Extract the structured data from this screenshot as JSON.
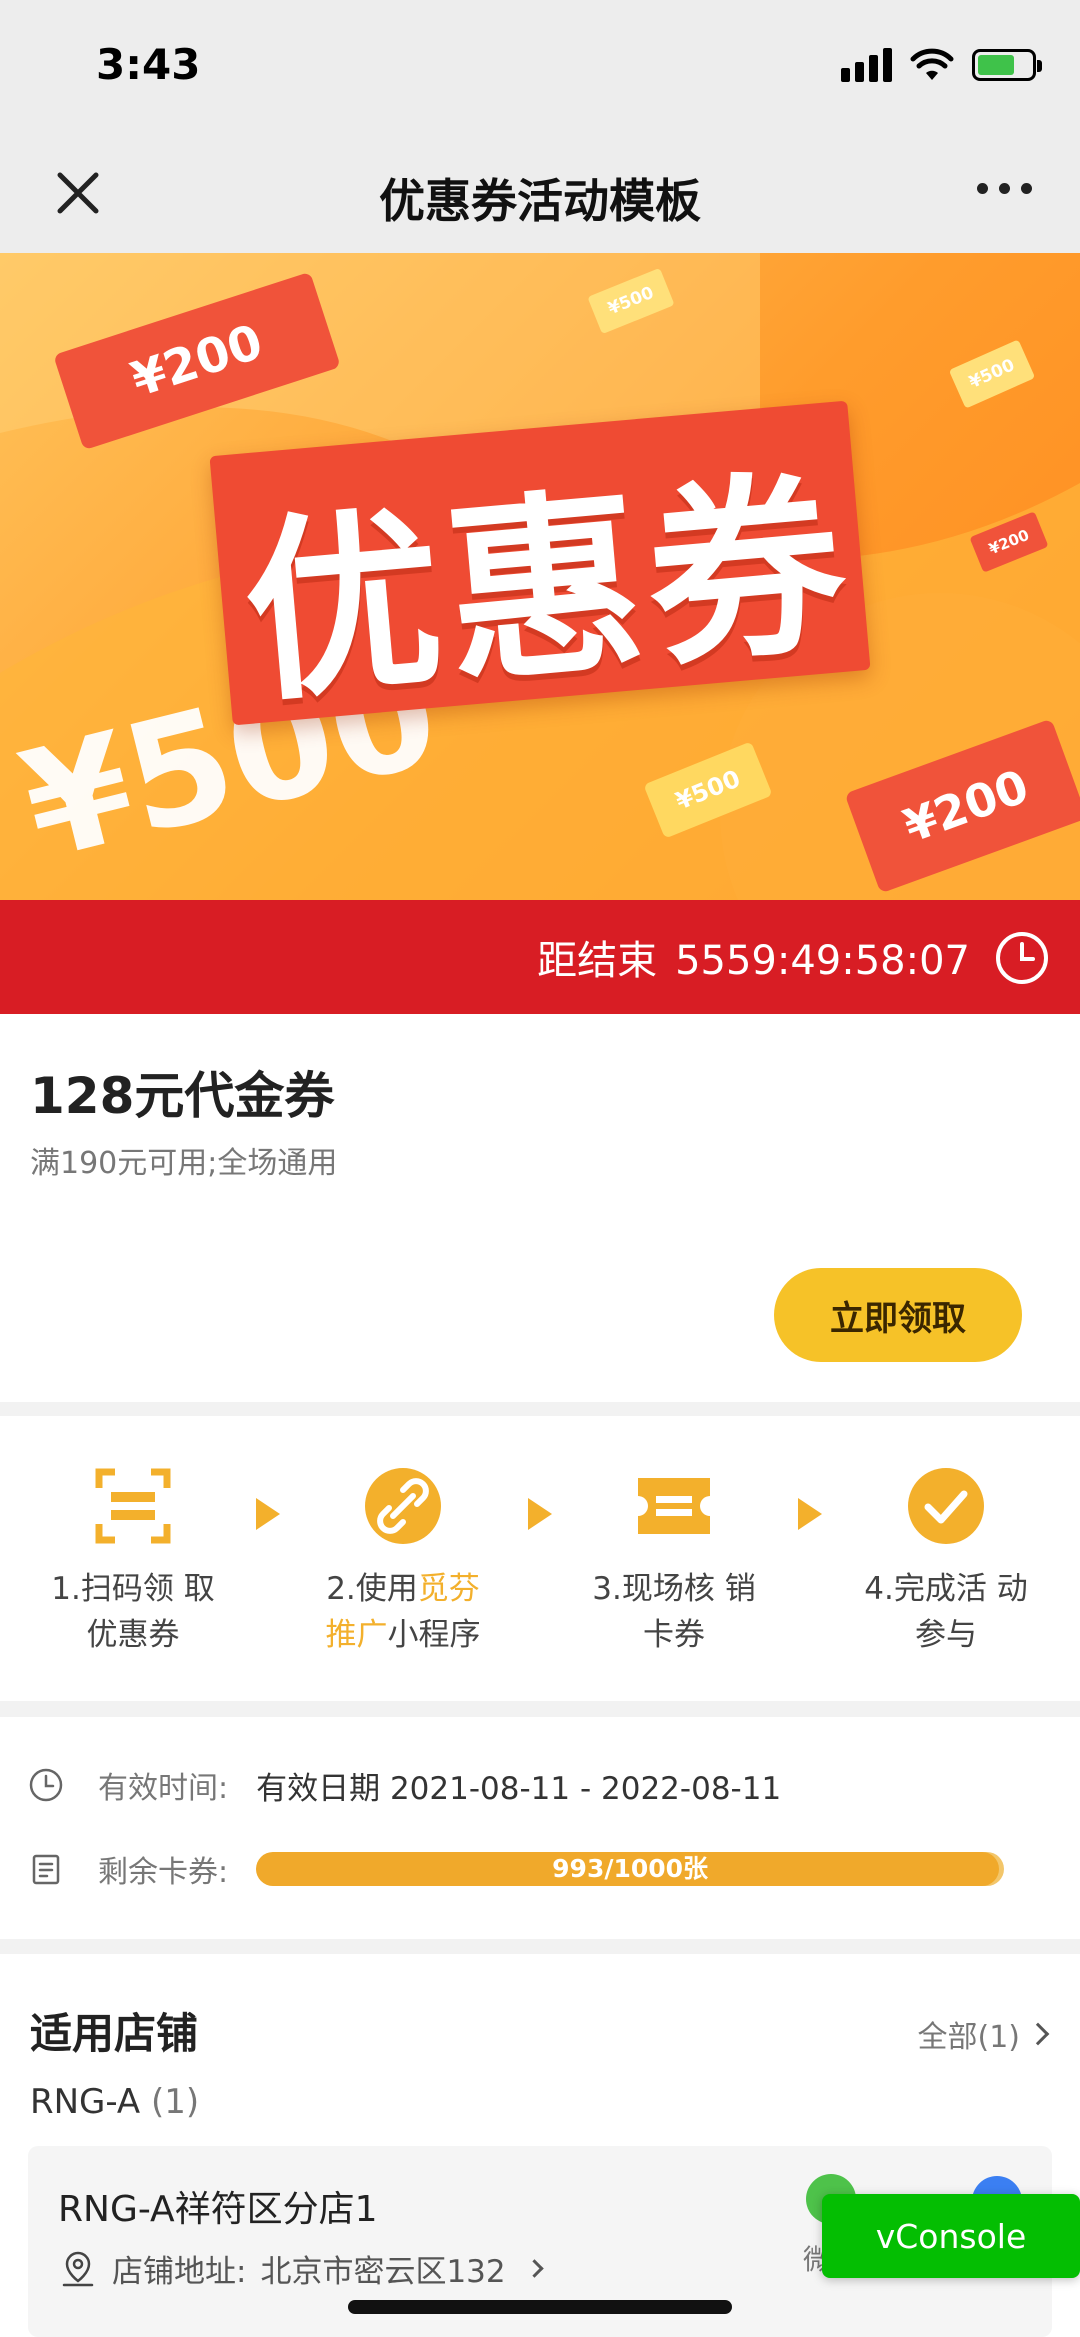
{
  "status_bar": {
    "time": "3:43"
  },
  "nav": {
    "title": "优惠券活动模板"
  },
  "banner": {
    "main_text": "优惠券",
    "big_amount": "¥500",
    "tickets": [
      "¥200",
      "¥500",
      "¥500",
      "¥200",
      "¥500",
      "¥200"
    ]
  },
  "countdown": {
    "label": "距结束",
    "value": "5559:49:58:07"
  },
  "coupon": {
    "title": "128元代金券",
    "description": "满190元可用;全场通用",
    "claim_label": "立即领取"
  },
  "steps": [
    {
      "line1": "1.扫码领 取",
      "line2": "优惠券"
    },
    {
      "line1_a": "2.使用",
      "line1_b": "觅芬",
      "line2_a": "推广",
      "line2_b": "小程序"
    },
    {
      "line1": "3.现场核 销",
      "line2": "卡券"
    },
    {
      "line1": "4.完成活 动",
      "line2": "参与"
    }
  ],
  "validity": {
    "time_label": "有效时间:",
    "time_value": "有效日期 2021-08-11 - 2022-08-11",
    "remaining_label": "剩余卡券:",
    "remaining_text": "993/1000张",
    "remaining_fraction": 0.993
  },
  "stores": {
    "title": "适用店铺",
    "all_label": "全部(1)",
    "group_name": "RNG-A",
    "group_count": "(1)",
    "store": {
      "name": "RNG-A祥符区分店1",
      "address_label": "店铺地址:",
      "address": "北京市密云区132",
      "wechat_label": "微信"
    }
  },
  "vconsole": {
    "label": "vConsole"
  },
  "colors": {
    "accent": "#f6c228",
    "countdown_bg": "#d81d24",
    "highlight": "#f3b02c"
  }
}
